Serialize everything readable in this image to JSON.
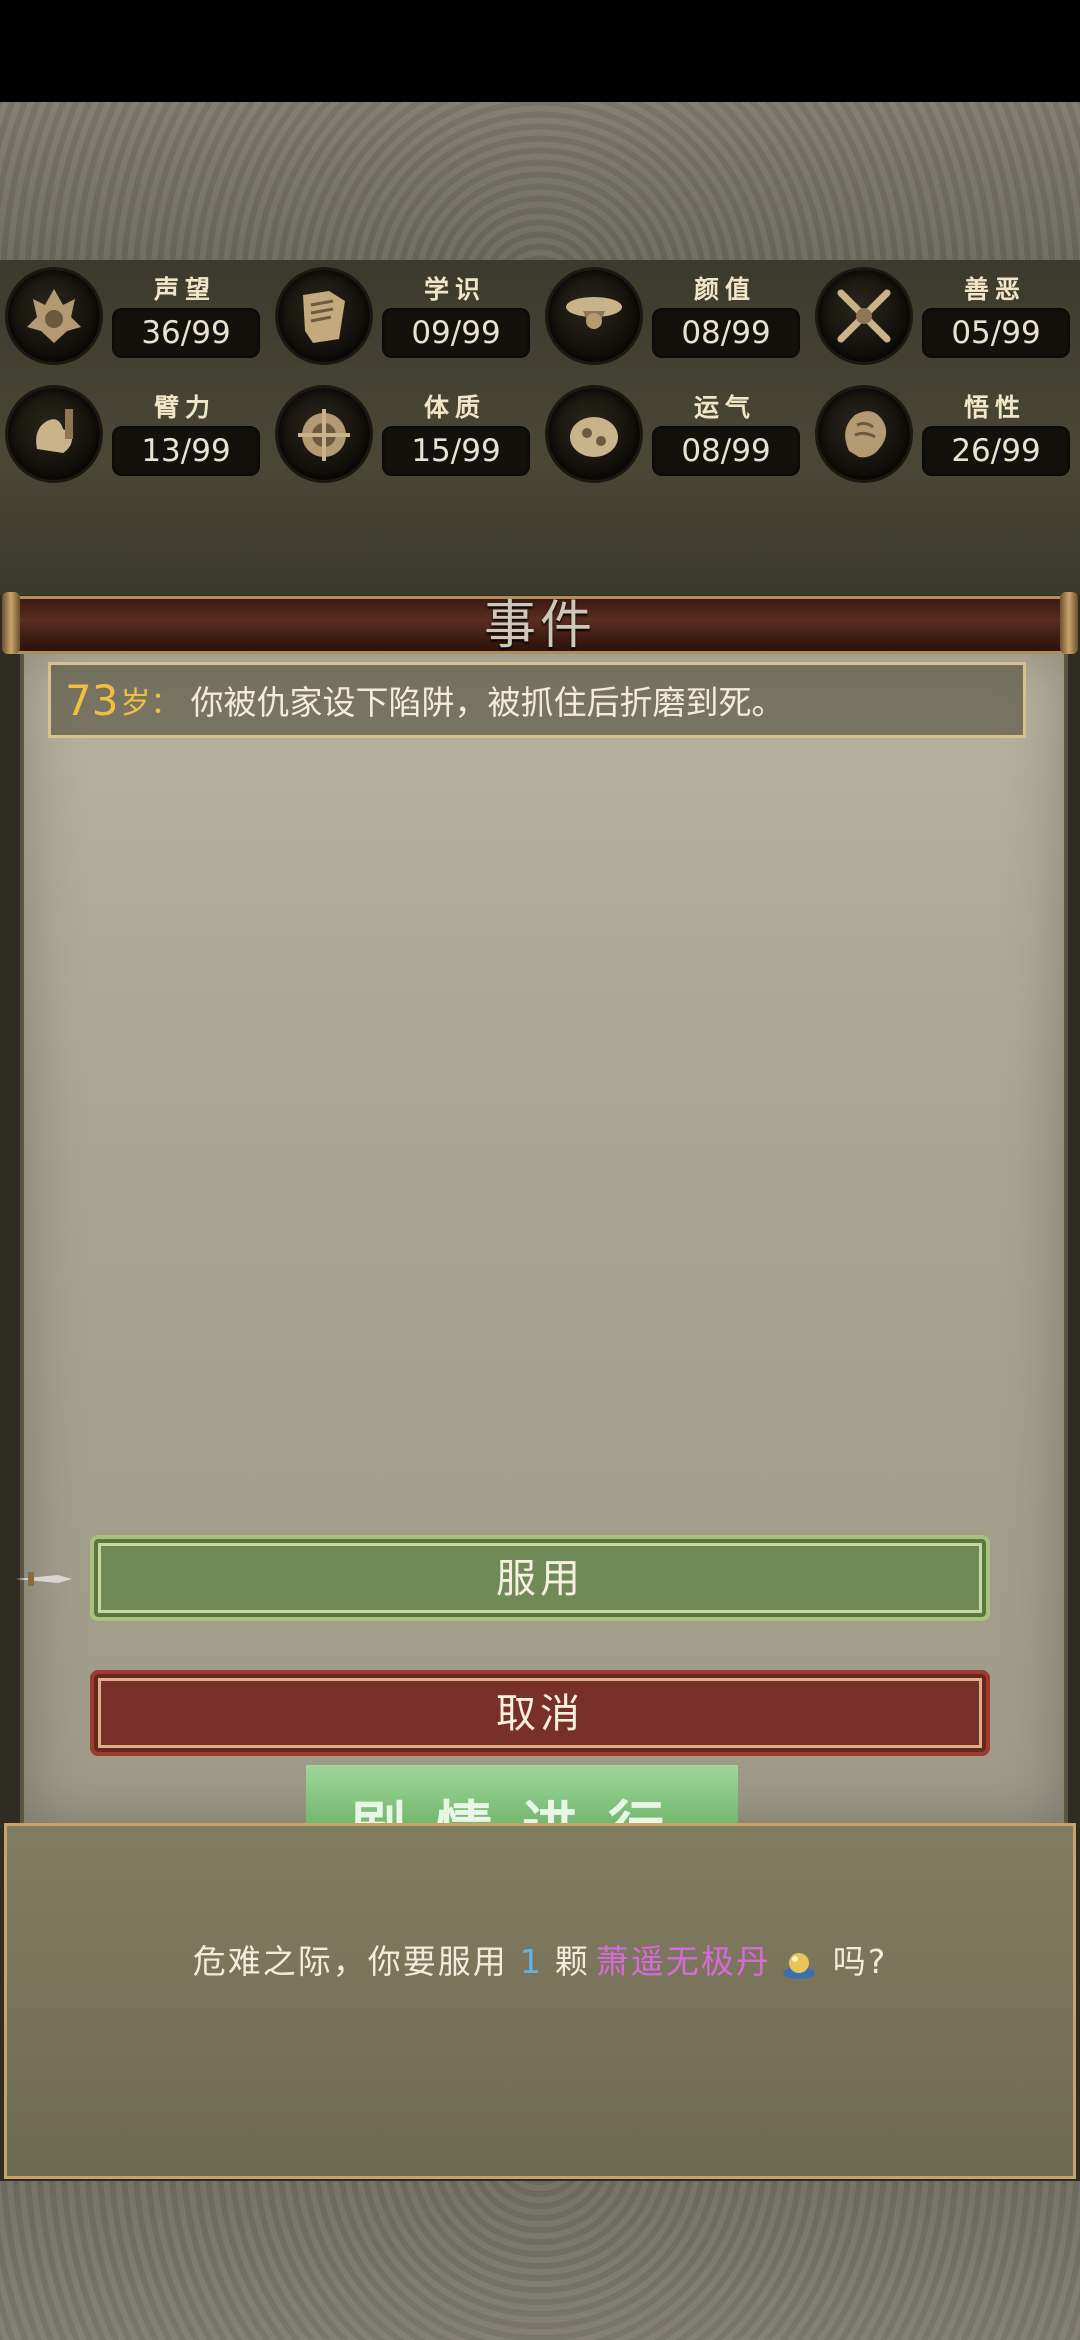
{
  "stats": [
    {
      "name": "声望",
      "value": "36/99",
      "icon": "reputation-icon"
    },
    {
      "name": "学识",
      "value": "09/99",
      "icon": "knowledge-icon"
    },
    {
      "name": "颜值",
      "value": "08/99",
      "icon": "appearance-icon"
    },
    {
      "name": "善恶",
      "value": "05/99",
      "icon": "morality-icon"
    },
    {
      "name": "臂力",
      "value": "13/99",
      "icon": "strength-icon"
    },
    {
      "name": "体质",
      "value": "15/99",
      "icon": "constitution-icon"
    },
    {
      "name": "运气",
      "value": "08/99",
      "icon": "luck-icon"
    },
    {
      "name": "悟性",
      "value": "26/99",
      "icon": "comprehension-icon"
    }
  ],
  "event": {
    "title": "事件",
    "age": "73",
    "age_unit": "岁：",
    "text": "你被仇家设下陷阱，被抓住后折磨到死。"
  },
  "choices": {
    "use_label": "服用",
    "cancel_label": "取消"
  },
  "hidden_tab_label": "剧情进行",
  "dialog": {
    "prefix": "危难之际，你要服用",
    "count": "1",
    "measure": "颗",
    "item": "萧遥无极丹",
    "suffix": "吗?"
  },
  "colors": {
    "use_button": "#6f8a56",
    "cancel_button": "#7a302a",
    "age_highlight": "#f0c040",
    "count_highlight": "#5fb6e4",
    "item_highlight": "#d56bd7"
  }
}
